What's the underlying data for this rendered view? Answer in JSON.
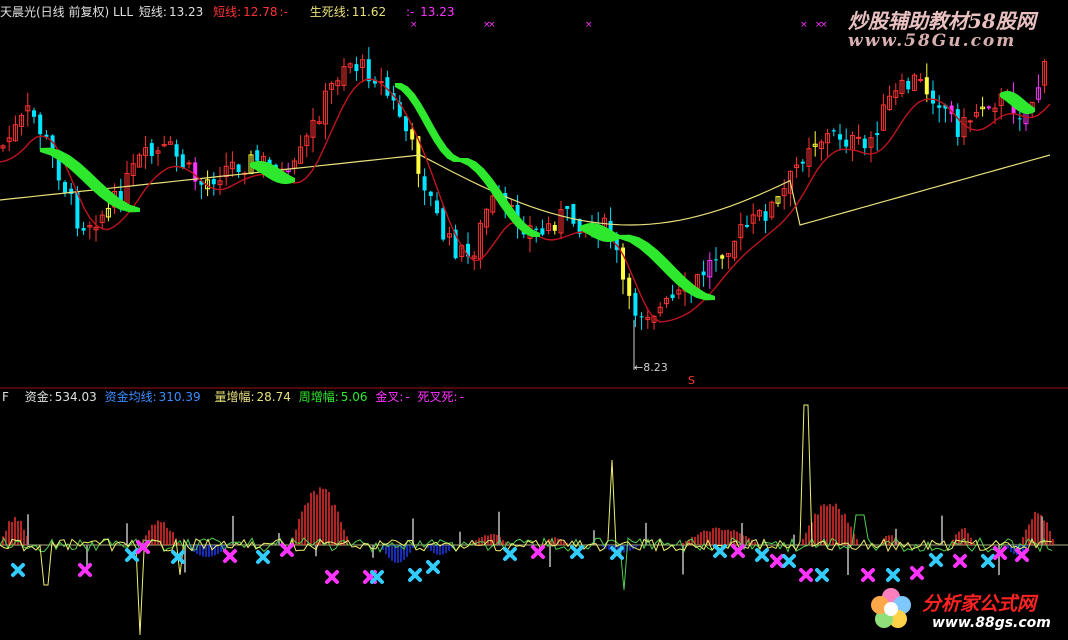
{
  "top_header": {
    "stock_name": "天晨光(日线 前复权) LLL",
    "short_line_label": "短线:",
    "short_line_value": "13.23",
    "long_line_label": "短线:",
    "long_line_value": "12.78",
    "long_line_suffix": ":-",
    "life_line_label": "生死线:",
    "life_line_value": "11.62",
    "extra_label": ":-",
    "extra_value": "13.23"
  },
  "bottom_header": {
    "prefix": "F",
    "fund_label": "资金:",
    "fund_value": "534.03",
    "fund_avg_label": "资金均线:",
    "fund_avg_value": "310.39",
    "vol_label": "量增幅:",
    "vol_value": "28.74",
    "week_label": "周增幅:",
    "week_value": "5.06",
    "golden_label": "金叉:",
    "golden_value": "-",
    "death_label": "死叉死:",
    "death_value": "-"
  },
  "low_price_marker": "8.23",
  "s_marker": "S",
  "watermark_top": {
    "text": "炒股辅助教材58股网",
    "url": "www.58Gu.com"
  },
  "watermark_bottom": {
    "text": "分析家公式网",
    "url": "www.88gs.com"
  },
  "colors": {
    "up": "#ff3333",
    "down": "#00e5ff",
    "ma_red": "#c0141c",
    "ma_yellow": "#e8e07a",
    "ribbon": "#2ee82e",
    "magenta": "#ff33ff",
    "separator": "#a01010"
  }
}
